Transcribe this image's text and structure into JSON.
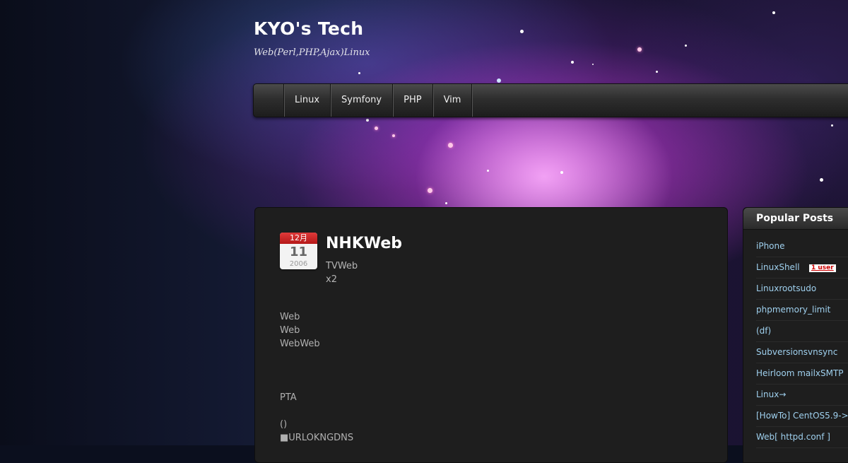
{
  "site": {
    "title": "KYO's Tech",
    "tagline": "Web(Perl,PHP,Ajax)Linux"
  },
  "nav": {
    "items": [
      "Linux",
      "Symfony",
      "PHP",
      "Vim"
    ]
  },
  "post": {
    "date": {
      "month": "12月",
      "day": "11",
      "year": "2006"
    },
    "title": "NHKWeb",
    "meta": [
      "TVWeb",
      "x2"
    ],
    "body": [
      "Web",
      "Web",
      "WebWeb",
      "",
      "",
      "",
      "PTA",
      "",
      "()",
      "■URLOKNGDNS"
    ]
  },
  "sidebar": {
    "heading": "Popular Posts",
    "items": [
      "iPhone",
      "LinuxShell",
      "Linuxrootsudo",
      "phpmemory_limit",
      "(df)",
      "Subversionsvnsync",
      "Heirloom mailxSMTP",
      "Linux→",
      "[HowTo] CentOS5.9->",
      "Web[ httpd.conf ]"
    ],
    "badge": "1 user"
  },
  "colors": {
    "accent_link": "#9fd0ee",
    "calendar_red": "#c62020",
    "panel_bg": "#1e1e1e"
  }
}
